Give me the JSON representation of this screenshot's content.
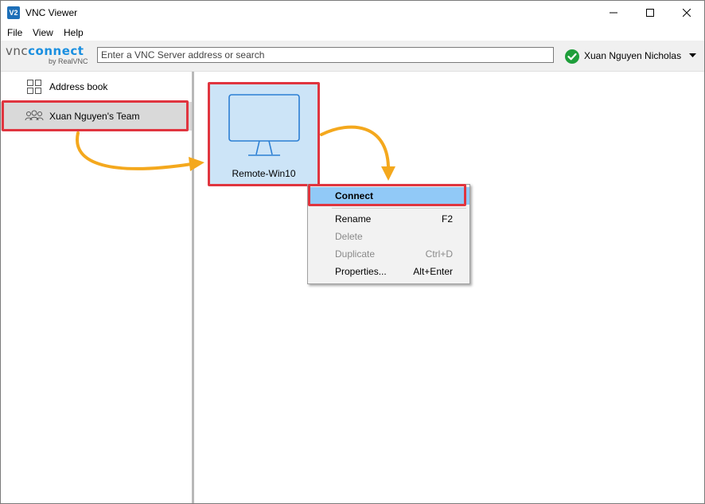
{
  "window": {
    "title": "VNC Viewer",
    "icon_text": "V2",
    "controls": [
      "minimize-icon",
      "maximize-icon",
      "close-icon"
    ]
  },
  "menubar": {
    "file": "File",
    "view": "View",
    "help": "Help"
  },
  "toolbar": {
    "logo_vnc": "vnc",
    "logo_connect": "connect",
    "logo_sub": "by RealVNC",
    "search_placeholder": "Enter a VNC Server address or search",
    "username": "Xuan Nguyen Nicholas",
    "status_icon": "check-circle-icon"
  },
  "sidebar": {
    "items": [
      {
        "label": "Address book",
        "icon": "grid-icon"
      },
      {
        "label": "Xuan Nguyen's Team",
        "icon": "team-icon",
        "selected": true
      }
    ]
  },
  "main": {
    "computers": [
      {
        "label": "Remote-Win10",
        "icon": "monitor-icon",
        "selected": true
      }
    ]
  },
  "context_menu": {
    "items": [
      {
        "label": "Connect",
        "shortcut": "",
        "enabled": true,
        "highlighted": true
      },
      {
        "label": "Rename",
        "shortcut": "F2",
        "enabled": true
      },
      {
        "label": "Delete",
        "shortcut": "",
        "enabled": false
      },
      {
        "label": "Duplicate",
        "shortcut": "Ctrl+D",
        "enabled": false
      },
      {
        "label": "Properties...",
        "shortcut": "Alt+Enter",
        "enabled": true
      }
    ]
  },
  "colors": {
    "accent": "#1a8fe0",
    "highlight_box": "#e0353f",
    "arrow": "#f4a81d",
    "tile_selected": "#cce4f7",
    "menu_highlight": "#91c9f7",
    "status_ok": "#1e9e3a"
  }
}
